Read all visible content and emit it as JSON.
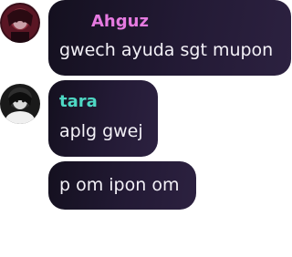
{
  "colors": {
    "bubble_background": "#1e172c",
    "message_text": "#f3f1f7",
    "username_pink": "#e57ae0",
    "username_teal": "#4ed8c4",
    "page_background": "#ffffff"
  },
  "messages": [
    {
      "username": "Ahguz",
      "username_color": "#e57ae0",
      "avatar_icon": "avatar-icon",
      "text": "gwech ayuda sgt mupon"
    },
    {
      "username": "tara",
      "username_color": "#4ed8c4",
      "avatar_icon": "avatar-icon",
      "text": "aplg gwej"
    },
    {
      "username": "",
      "text": "p om ipon om"
    }
  ]
}
